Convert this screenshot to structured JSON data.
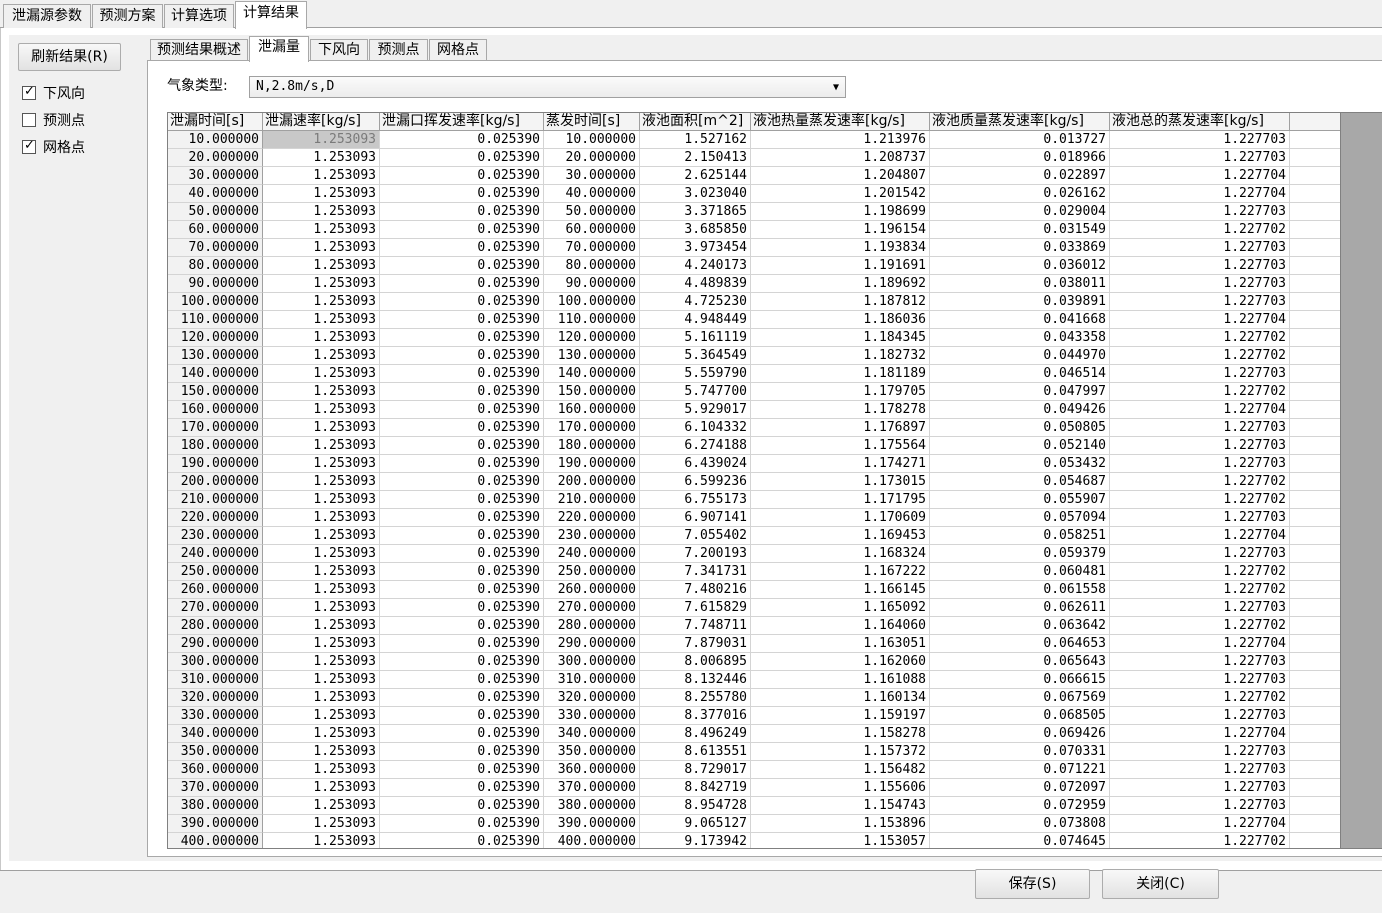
{
  "top_tabs": [
    {
      "label": "泄漏源参数"
    },
    {
      "label": "预测方案"
    },
    {
      "label": "计算选项"
    },
    {
      "label": "计算结果",
      "active": true
    }
  ],
  "left_panel": {
    "refresh_button": "刷新结果(R)",
    "checkboxes": [
      {
        "label": "下风向",
        "checked": true
      },
      {
        "label": "预测点",
        "checked": false
      },
      {
        "label": "网格点",
        "checked": true
      }
    ]
  },
  "inner_tabs": [
    {
      "label": "预测结果概述"
    },
    {
      "label": "泄漏量",
      "active": true
    },
    {
      "label": "下风向"
    },
    {
      "label": "预测点"
    },
    {
      "label": "网格点"
    }
  ],
  "weather": {
    "label": "气象类型:",
    "value": "N,2.8m/s,D"
  },
  "table": {
    "columns": [
      "泄漏时间[s]",
      "泄漏速率[kg/s]",
      "泄漏口挥发速率[kg/s]",
      "蒸发时间[s]",
      "液池面积[m^2]",
      "液池热量蒸发速率[kg/s]",
      "液池质量蒸发速率[kg/s]",
      "液池总的蒸发速率[kg/s]",
      ""
    ],
    "rows": [
      [
        "10.000000",
        "1.253093",
        "0.025390",
        "10.000000",
        "1.527162",
        "1.213976",
        "0.013727",
        "1.227703"
      ],
      [
        "20.000000",
        "1.253093",
        "0.025390",
        "20.000000",
        "2.150413",
        "1.208737",
        "0.018966",
        "1.227703"
      ],
      [
        "30.000000",
        "1.253093",
        "0.025390",
        "30.000000",
        "2.625144",
        "1.204807",
        "0.022897",
        "1.227704"
      ],
      [
        "40.000000",
        "1.253093",
        "0.025390",
        "40.000000",
        "3.023040",
        "1.201542",
        "0.026162",
        "1.227704"
      ],
      [
        "50.000000",
        "1.253093",
        "0.025390",
        "50.000000",
        "3.371865",
        "1.198699",
        "0.029004",
        "1.227703"
      ],
      [
        "60.000000",
        "1.253093",
        "0.025390",
        "60.000000",
        "3.685850",
        "1.196154",
        "0.031549",
        "1.227702"
      ],
      [
        "70.000000",
        "1.253093",
        "0.025390",
        "70.000000",
        "3.973454",
        "1.193834",
        "0.033869",
        "1.227703"
      ],
      [
        "80.000000",
        "1.253093",
        "0.025390",
        "80.000000",
        "4.240173",
        "1.191691",
        "0.036012",
        "1.227703"
      ],
      [
        "90.000000",
        "1.253093",
        "0.025390",
        "90.000000",
        "4.489839",
        "1.189692",
        "0.038011",
        "1.227703"
      ],
      [
        "100.000000",
        "1.253093",
        "0.025390",
        "100.000000",
        "4.725230",
        "1.187812",
        "0.039891",
        "1.227703"
      ],
      [
        "110.000000",
        "1.253093",
        "0.025390",
        "110.000000",
        "4.948449",
        "1.186036",
        "0.041668",
        "1.227704"
      ],
      [
        "120.000000",
        "1.253093",
        "0.025390",
        "120.000000",
        "5.161119",
        "1.184345",
        "0.043358",
        "1.227702"
      ],
      [
        "130.000000",
        "1.253093",
        "0.025390",
        "130.000000",
        "5.364549",
        "1.182732",
        "0.044970",
        "1.227702"
      ],
      [
        "140.000000",
        "1.253093",
        "0.025390",
        "140.000000",
        "5.559790",
        "1.181189",
        "0.046514",
        "1.227703"
      ],
      [
        "150.000000",
        "1.253093",
        "0.025390",
        "150.000000",
        "5.747700",
        "1.179705",
        "0.047997",
        "1.227702"
      ],
      [
        "160.000000",
        "1.253093",
        "0.025390",
        "160.000000",
        "5.929017",
        "1.178278",
        "0.049426",
        "1.227704"
      ],
      [
        "170.000000",
        "1.253093",
        "0.025390",
        "170.000000",
        "6.104332",
        "1.176897",
        "0.050805",
        "1.227703"
      ],
      [
        "180.000000",
        "1.253093",
        "0.025390",
        "180.000000",
        "6.274188",
        "1.175564",
        "0.052140",
        "1.227703"
      ],
      [
        "190.000000",
        "1.253093",
        "0.025390",
        "190.000000",
        "6.439024",
        "1.174271",
        "0.053432",
        "1.227703"
      ],
      [
        "200.000000",
        "1.253093",
        "0.025390",
        "200.000000",
        "6.599236",
        "1.173015",
        "0.054687",
        "1.227702"
      ],
      [
        "210.000000",
        "1.253093",
        "0.025390",
        "210.000000",
        "6.755173",
        "1.171795",
        "0.055907",
        "1.227702"
      ],
      [
        "220.000000",
        "1.253093",
        "0.025390",
        "220.000000",
        "6.907141",
        "1.170609",
        "0.057094",
        "1.227703"
      ],
      [
        "230.000000",
        "1.253093",
        "0.025390",
        "230.000000",
        "7.055402",
        "1.169453",
        "0.058251",
        "1.227704"
      ],
      [
        "240.000000",
        "1.253093",
        "0.025390",
        "240.000000",
        "7.200193",
        "1.168324",
        "0.059379",
        "1.227703"
      ],
      [
        "250.000000",
        "1.253093",
        "0.025390",
        "250.000000",
        "7.341731",
        "1.167222",
        "0.060481",
        "1.227702"
      ],
      [
        "260.000000",
        "1.253093",
        "0.025390",
        "260.000000",
        "7.480216",
        "1.166145",
        "0.061558",
        "1.227702"
      ],
      [
        "270.000000",
        "1.253093",
        "0.025390",
        "270.000000",
        "7.615829",
        "1.165092",
        "0.062611",
        "1.227703"
      ],
      [
        "280.000000",
        "1.253093",
        "0.025390",
        "280.000000",
        "7.748711",
        "1.164060",
        "0.063642",
        "1.227702"
      ],
      [
        "290.000000",
        "1.253093",
        "0.025390",
        "290.000000",
        "7.879031",
        "1.163051",
        "0.064653",
        "1.227704"
      ],
      [
        "300.000000",
        "1.253093",
        "0.025390",
        "300.000000",
        "8.006895",
        "1.162060",
        "0.065643",
        "1.227703"
      ],
      [
        "310.000000",
        "1.253093",
        "0.025390",
        "310.000000",
        "8.132446",
        "1.161088",
        "0.066615",
        "1.227703"
      ],
      [
        "320.000000",
        "1.253093",
        "0.025390",
        "320.000000",
        "8.255780",
        "1.160134",
        "0.067569",
        "1.227702"
      ],
      [
        "330.000000",
        "1.253093",
        "0.025390",
        "330.000000",
        "8.377016",
        "1.159197",
        "0.068505",
        "1.227703"
      ],
      [
        "340.000000",
        "1.253093",
        "0.025390",
        "340.000000",
        "8.496249",
        "1.158278",
        "0.069426",
        "1.227704"
      ],
      [
        "350.000000",
        "1.253093",
        "0.025390",
        "350.000000",
        "8.613551",
        "1.157372",
        "0.070331",
        "1.227703"
      ],
      [
        "360.000000",
        "1.253093",
        "0.025390",
        "360.000000",
        "8.729017",
        "1.156482",
        "0.071221",
        "1.227703"
      ],
      [
        "370.000000",
        "1.253093",
        "0.025390",
        "370.000000",
        "8.842719",
        "1.155606",
        "0.072097",
        "1.227703"
      ],
      [
        "380.000000",
        "1.253093",
        "0.025390",
        "380.000000",
        "8.954728",
        "1.154743",
        "0.072959",
        "1.227703"
      ],
      [
        "390.000000",
        "1.253093",
        "0.025390",
        "390.000000",
        "9.065127",
        "1.153896",
        "0.073808",
        "1.227704"
      ],
      [
        "400.000000",
        "1.253093",
        "0.025390",
        "400.000000",
        "9.173942",
        "1.153057",
        "0.074645",
        "1.227702"
      ]
    ]
  },
  "bottom": {
    "save_button": "保存(S)",
    "close_button": "关闭(C)"
  }
}
